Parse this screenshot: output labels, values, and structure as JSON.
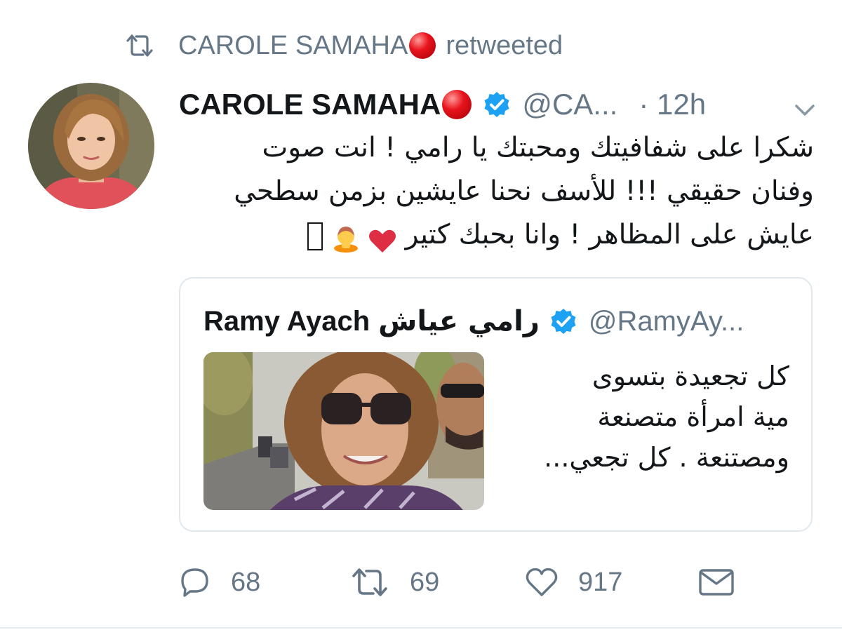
{
  "retweet_banner": {
    "user": "CAROLE SAMAHA",
    "action": "retweeted"
  },
  "tweet": {
    "author_name": "CAROLE SAMAHA",
    "author_handle": "@CA...",
    "time": "· 12h",
    "verified": true,
    "text_lines": [
      "شكرا على شفافيتك ومحبتك يا رامي ! انت صوت",
      "وفنان حقيقي !!! للأسف نحنا عايشين بزمن سطحي",
      "عايش على المظاهر ! وانا بحبك كتير"
    ]
  },
  "quoted_tweet": {
    "author_name": "Ramy Ayach",
    "author_name_ar": "رامي عياش",
    "author_handle": "@RamyAy...",
    "verified": true,
    "text_lines": [
      "كل تجعيدة بتسوى",
      "مية امرأة متصنعة",
      "ومصتنعة . كل تجعي..."
    ]
  },
  "actions": {
    "replies": "68",
    "retweets": "69",
    "likes": "917"
  },
  "colors": {
    "text_primary": "#14171a",
    "text_secondary": "#657786",
    "verified_blue": "#1da1f2",
    "border": "#e1e8ed",
    "heart_red": "#e0245e"
  }
}
